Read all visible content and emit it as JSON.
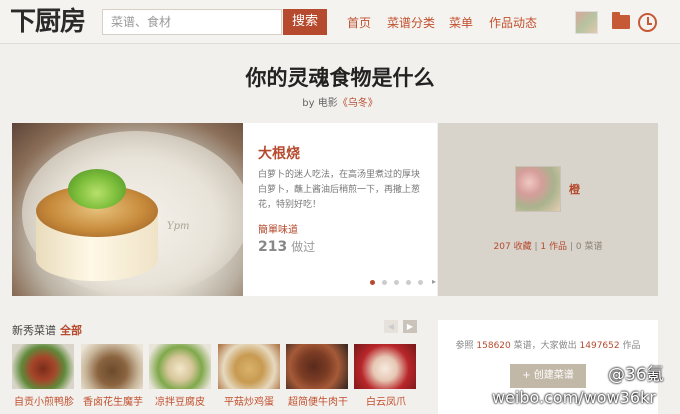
{
  "header": {
    "logo": "下厨房",
    "search_placeholder": "菜谱、食材",
    "search_button": "搜索",
    "nav": [
      "首页",
      "菜谱分类",
      "菜单",
      "作品动态"
    ]
  },
  "headline": {
    "title": "你的灵魂食物是什么",
    "by_prefix": "by 电影",
    "by_source": "《乌冬》"
  },
  "feature": {
    "image_watermark": "Ypm",
    "recipe_title": "大根烧",
    "description": "白萝卜的迷人吃法，在高汤里煮过的厚块白萝卜，蘸上酱油后稍煎一下，再撒上葱花，特别好吃！",
    "tag": "簡單味道",
    "cook_count": "213",
    "cook_suffix": "做过",
    "carousel_dots": 5,
    "carousel_active": 1
  },
  "author": {
    "name": "橙",
    "collections": "207",
    "collections_label": "收藏",
    "works": "1",
    "works_label": "作品",
    "recipes": "0",
    "recipes_label": "菜谱"
  },
  "new_recipes": {
    "title": "新秀菜谱",
    "all_label": "全部",
    "items": [
      {
        "label": "自贡小煎鸭胗"
      },
      {
        "label": "香卤花生魔芋"
      },
      {
        "label": "凉拌豆腐皮"
      },
      {
        "label": "平菇炒鸡蛋"
      },
      {
        "label": "超简便牛肉干"
      },
      {
        "label": "白云凤爪"
      }
    ]
  },
  "site_stats": {
    "prefix": "参照",
    "recipe_count": "158620",
    "middle": "菜谱，大家做出",
    "work_count": "1497652",
    "suffix": "作品",
    "create_button": "+ 创建菜谱"
  },
  "overlays": {
    "kr": "@36氪",
    "weibo": "weibo.com/wow36kr"
  },
  "colors": {
    "accent": "#b54a2e",
    "background": "#f2f0ec"
  }
}
